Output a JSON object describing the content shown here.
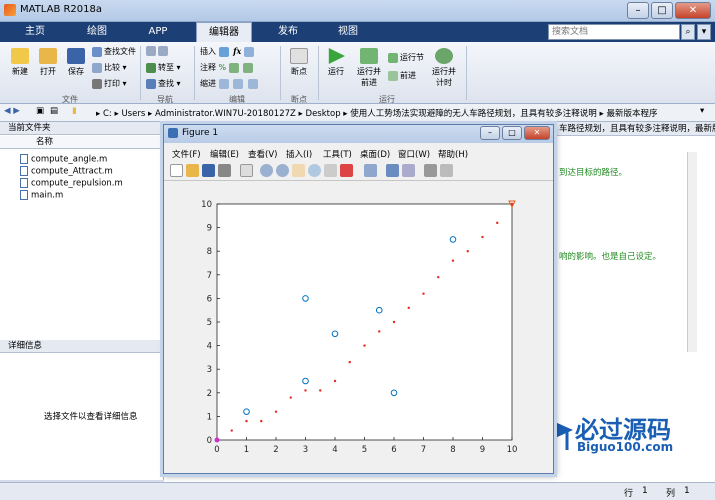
{
  "window": {
    "title": "MATLAB R2018a"
  },
  "tabs": [
    "主页",
    "绘图",
    "APP",
    "编辑器",
    "发布",
    "视图"
  ],
  "search": {
    "placeholder": "搜索文档"
  },
  "ribbon": {
    "new": "新建",
    "open": "打开",
    "save": "保存",
    "find_files": "查找文件",
    "compare": "比较",
    "print": "打印",
    "goto": "转至",
    "find": "查找",
    "insert": "插入",
    "comment": "注释",
    "indent": "缩进",
    "breakpoints": "断点",
    "run": "运行",
    "run_advance_1": "运行并",
    "run_advance_2": "前进",
    "run_section": "运行节",
    "advance": "前进",
    "run_time_1": "运行并",
    "run_time_2": "计时",
    "groups": {
      "file": "文件",
      "nav": "导航",
      "edit": "编辑",
      "bp": "断点",
      "run": "运行"
    }
  },
  "address": {
    "parts": [
      "C:",
      "Users",
      "Administrator.WIN7U-20180127Z",
      "Desktop",
      "使用人工势场法实现避障的无人车路径规划，且具有较多注释说明",
      "最新版本程序"
    ]
  },
  "current_folder": {
    "header": "当前文件夹",
    "col_name": "名称",
    "files": [
      "compute_angle.m",
      "compute_Attract.m",
      "compute_repulsion.m",
      "main.m"
    ]
  },
  "details": {
    "header": "详细信息",
    "hint": "选择文件以查看详细信息"
  },
  "editor": {
    "tab_partial": "车路径规划，且具有较多注释说明，最新版本程序",
    "comment1": "到达目标的路径。",
    "comment2": "响的影响。也是自己设定。"
  },
  "status": {
    "row_label": "行",
    "row": "1",
    "col_label": "列",
    "col": "1"
  },
  "figure": {
    "title": "Figure 1",
    "menu": [
      "文件(F)",
      "编辑(E)",
      "查看(V)",
      "插入(I)",
      "工具(T)",
      "桌面(D)",
      "窗口(W)",
      "帮助(H)"
    ]
  },
  "watermark": {
    "cn": "必过源码",
    "url": "Biguo100.com"
  },
  "chart_data": {
    "type": "scatter",
    "xlim": [
      0,
      10
    ],
    "ylim": [
      0,
      10
    ],
    "xticks": [
      0,
      1,
      2,
      3,
      4,
      5,
      6,
      7,
      8,
      9,
      10
    ],
    "yticks": [
      0,
      1,
      2,
      3,
      4,
      5,
      6,
      7,
      8,
      9,
      10
    ],
    "series": [
      {
        "marker": "circle",
        "color": "#0072bd",
        "x": [
          1,
          3,
          3,
          4,
          5.5,
          6,
          8
        ],
        "y": [
          1.2,
          6,
          2.5,
          4.5,
          5.5,
          2,
          8.5
        ]
      },
      {
        "marker": "dot",
        "color": "#e8281c",
        "x": [
          0,
          0.5,
          1,
          1.5,
          2,
          2.5,
          3,
          3.5,
          4,
          4.5,
          5,
          5.5,
          6,
          6.5,
          7,
          7.5,
          8,
          8.5,
          9,
          9.5,
          10
        ],
        "y": [
          0,
          0.4,
          0.8,
          0.8,
          1.2,
          1.8,
          2.1,
          2.1,
          2.5,
          3.3,
          4.0,
          4.6,
          5.0,
          5.6,
          6.2,
          6.9,
          7.6,
          8.0,
          8.6,
          9.2,
          10
        ]
      },
      {
        "marker": "triangle",
        "color": "#e8581c",
        "x": [
          10
        ],
        "y": [
          10
        ]
      },
      {
        "marker": "start",
        "color": "#cc33cc",
        "x": [
          0
        ],
        "y": [
          0
        ]
      }
    ]
  }
}
